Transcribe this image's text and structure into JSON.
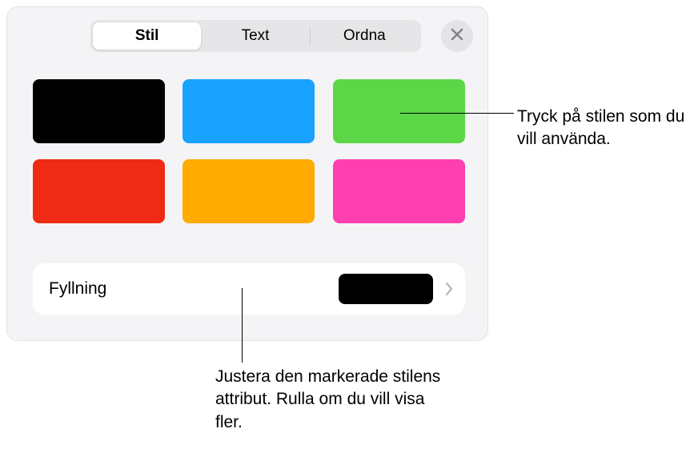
{
  "tabs": {
    "stil": "Stil",
    "text": "Text",
    "ordna": "Ordna"
  },
  "swatches": {
    "colors": [
      "#000000",
      "#1aa2ff",
      "#5bd647",
      "#ef2b16",
      "#ffab00",
      "#ff3eb0"
    ]
  },
  "fill": {
    "label": "Fyllning",
    "preview_color": "#000000"
  },
  "callouts": {
    "tap_style": "Tryck på stilen som du vill använda.",
    "adjust_attrs": "Justera den markerade stilens attribut. Rulla om du vill visa fler."
  }
}
